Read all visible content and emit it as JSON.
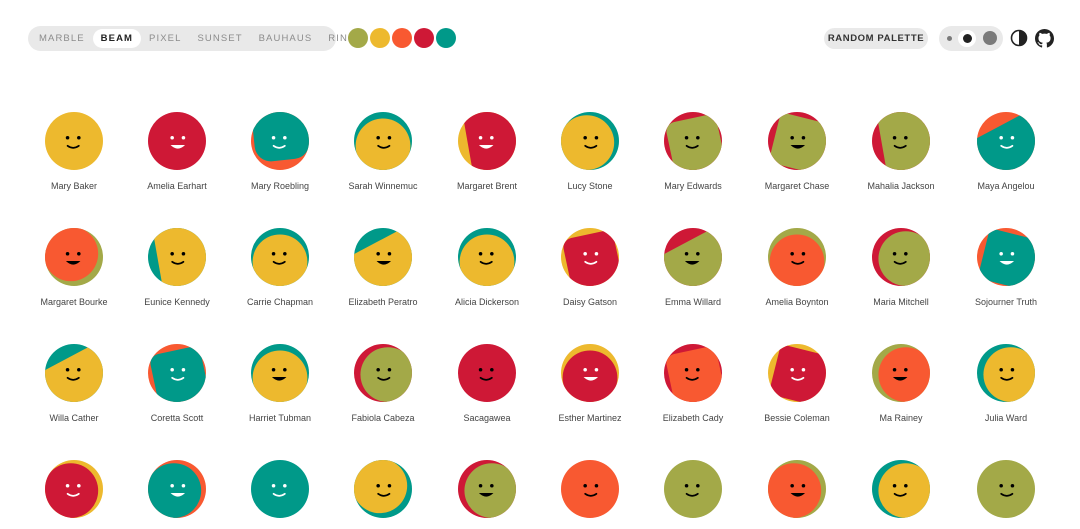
{
  "toolbar": {
    "variants": [
      "MARBLE",
      "BEAM",
      "PIXEL",
      "SUNSET",
      "BAUHAUS",
      "RING"
    ],
    "active_variant": "BEAM",
    "palette": [
      "#a3a948",
      "#edb92e",
      "#f85931",
      "#ce1836",
      "#009989"
    ],
    "random_palette_label": "RANDOM PALETTE",
    "size_options": [
      "small",
      "medium",
      "large"
    ],
    "selected_size": "medium",
    "theme_icon": "contrast-icon",
    "github_icon": "github-icon"
  },
  "avatars": [
    {
      "name": "Mary Baker",
      "bg": "#edb92e",
      "fg": "#edb92e",
      "face": "#000000",
      "shape": "none"
    },
    {
      "name": "Amelia Earhart",
      "bg": "#ce1836",
      "fg": "#ce1836",
      "face": "#ffffff",
      "shape": "none"
    },
    {
      "name": "Mary Roebling",
      "bg": "#f85931",
      "fg": "#009989",
      "face": "#ffffff",
      "shape": "rect-up"
    },
    {
      "name": "Sarah Winnemuc",
      "bg": "#009989",
      "fg": "#edb92e",
      "face": "#000000",
      "shape": "circle-down"
    },
    {
      "name": "Margaret Brent",
      "bg": "#edb92e",
      "fg": "#ce1836",
      "face": "#ffffff",
      "shape": "rect-right"
    },
    {
      "name": "Lucy Stone",
      "bg": "#009989",
      "fg": "#edb92e",
      "face": "#000000",
      "shape": "circle-left"
    },
    {
      "name": "Mary Edwards",
      "bg": "#ce1836",
      "fg": "#a3a948",
      "face": "#000000",
      "shape": "rect-tilt"
    },
    {
      "name": "Margaret Chase",
      "bg": "#ce1836",
      "fg": "#a3a948",
      "face": "#000000",
      "shape": "rect-tilt2"
    },
    {
      "name": "Mahalia Jackson",
      "bg": "#ce1836",
      "fg": "#a3a948",
      "face": "#000000",
      "shape": "rect-right"
    },
    {
      "name": "Maya Angelou",
      "bg": "#f85931",
      "fg": "#009989",
      "face": "#ffffff",
      "shape": "rect-diag"
    },
    {
      "name": "Margaret Bourke",
      "bg": "#a3a948",
      "fg": "#f85931",
      "face": "#000000",
      "shape": "circle-up"
    },
    {
      "name": "Eunice Kennedy",
      "bg": "#009989",
      "fg": "#edb92e",
      "face": "#000000",
      "shape": "rect-right"
    },
    {
      "name": "Carrie Chapman",
      "bg": "#009989",
      "fg": "#edb92e",
      "face": "#000000",
      "shape": "circle-down"
    },
    {
      "name": "Elizabeth Peratro",
      "bg": "#009989",
      "fg": "#edb92e",
      "face": "#000000",
      "shape": "rect-diag"
    },
    {
      "name": "Alicia Dickerson",
      "bg": "#009989",
      "fg": "#edb92e",
      "face": "#000000",
      "shape": "circle-down"
    },
    {
      "name": "Daisy Gatson",
      "bg": "#edb92e",
      "fg": "#ce1836",
      "face": "#ffffff",
      "shape": "rect-tilt"
    },
    {
      "name": "Emma Willard",
      "bg": "#ce1836",
      "fg": "#a3a948",
      "face": "#000000",
      "shape": "rect-diag"
    },
    {
      "name": "Amelia Boynton",
      "bg": "#a3a948",
      "fg": "#f85931",
      "face": "#000000",
      "shape": "circle-down"
    },
    {
      "name": "Maria Mitchell",
      "bg": "#ce1836",
      "fg": "#a3a948",
      "face": "#000000",
      "shape": "circle-right"
    },
    {
      "name": "Sojourner Truth",
      "bg": "#f85931",
      "fg": "#009989",
      "face": "#ffffff",
      "shape": "rect-tilt2"
    },
    {
      "name": "Willa Cather",
      "bg": "#009989",
      "fg": "#edb92e",
      "face": "#000000",
      "shape": "rect-diag"
    },
    {
      "name": "Coretta Scott",
      "bg": "#f85931",
      "fg": "#009989",
      "face": "#ffffff",
      "shape": "rect-tilt"
    },
    {
      "name": "Harriet Tubman",
      "bg": "#009989",
      "fg": "#edb92e",
      "face": "#000000",
      "shape": "circle-down"
    },
    {
      "name": "Fabiola Cabeza",
      "bg": "#ce1836",
      "fg": "#a3a948",
      "face": "#000000",
      "shape": "circle-right"
    },
    {
      "name": "Sacagawea",
      "bg": "#ce1836",
      "fg": "#ce1836",
      "face": "#000000",
      "shape": "none"
    },
    {
      "name": "Esther Martinez",
      "bg": "#edb92e",
      "fg": "#ce1836",
      "face": "#ffffff",
      "shape": "circle-down"
    },
    {
      "name": "Elizabeth Cady",
      "bg": "#ce1836",
      "fg": "#f85931",
      "face": "#000000",
      "shape": "rect-tilt"
    },
    {
      "name": "Bessie Coleman",
      "bg": "#edb92e",
      "fg": "#ce1836",
      "face": "#ffffff",
      "shape": "rect-tilt2"
    },
    {
      "name": "Ma Rainey",
      "bg": "#a3a948",
      "fg": "#f85931",
      "face": "#000000",
      "shape": "circle-right"
    },
    {
      "name": "Julia Ward",
      "bg": "#009989",
      "fg": "#edb92e",
      "face": "#000000",
      "shape": "circle-right"
    },
    {
      "name": "",
      "bg": "#edb92e",
      "fg": "#ce1836",
      "face": "#ffffff",
      "shape": "circle-left"
    },
    {
      "name": "",
      "bg": "#f85931",
      "fg": "#009989",
      "face": "#ffffff",
      "shape": "circle-left"
    },
    {
      "name": "",
      "bg": "#009989",
      "fg": "#009989",
      "face": "#ffffff",
      "shape": "none"
    },
    {
      "name": "",
      "bg": "#009989",
      "fg": "#edb92e",
      "face": "#000000",
      "shape": "circle-up"
    },
    {
      "name": "",
      "bg": "#ce1836",
      "fg": "#a3a948",
      "face": "#000000",
      "shape": "circle-right"
    },
    {
      "name": "",
      "bg": "#f85931",
      "fg": "#f85931",
      "face": "#000000",
      "shape": "none"
    },
    {
      "name": "",
      "bg": "#a3a948",
      "fg": "#a3a948",
      "face": "#000000",
      "shape": "none"
    },
    {
      "name": "",
      "bg": "#a3a948",
      "fg": "#f85931",
      "face": "#000000",
      "shape": "circle-left"
    },
    {
      "name": "",
      "bg": "#009989",
      "fg": "#edb92e",
      "face": "#000000",
      "shape": "circle-right"
    },
    {
      "name": "",
      "bg": "#a3a948",
      "fg": "#a3a948",
      "face": "#000000",
      "shape": "none"
    }
  ]
}
